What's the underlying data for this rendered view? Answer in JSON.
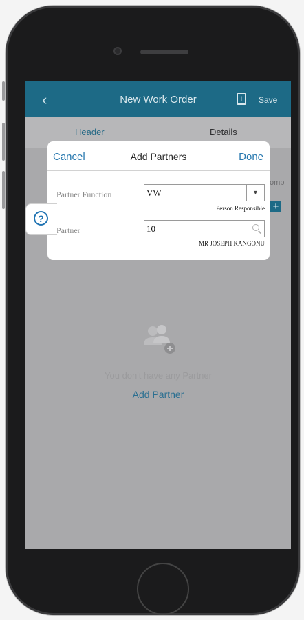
{
  "navbar": {
    "title": "New Work Order",
    "save_label": "Save",
    "back_icon": "chevron-left-icon",
    "save_icon": "document-icon"
  },
  "tabs": {
    "header": "Header",
    "details": "Details"
  },
  "background": {
    "partial_text": "omp",
    "plus": "+"
  },
  "empty_state": {
    "message": "You don't have any Partner",
    "add_link": "Add Partner",
    "icon": "partners-add-icon"
  },
  "modal": {
    "cancel": "Cancel",
    "title": "Add Partners",
    "done": "Done",
    "partner_function": {
      "label": "Partner Function",
      "value": "VW",
      "description": "Person Responsible"
    },
    "partner": {
      "label": "Partner",
      "value": "10",
      "description": "MR JOSEPH KANGONU"
    }
  },
  "help": {
    "symbol": "?"
  },
  "colors": {
    "accent": "#1d6a86",
    "link": "#2a7ab0"
  }
}
